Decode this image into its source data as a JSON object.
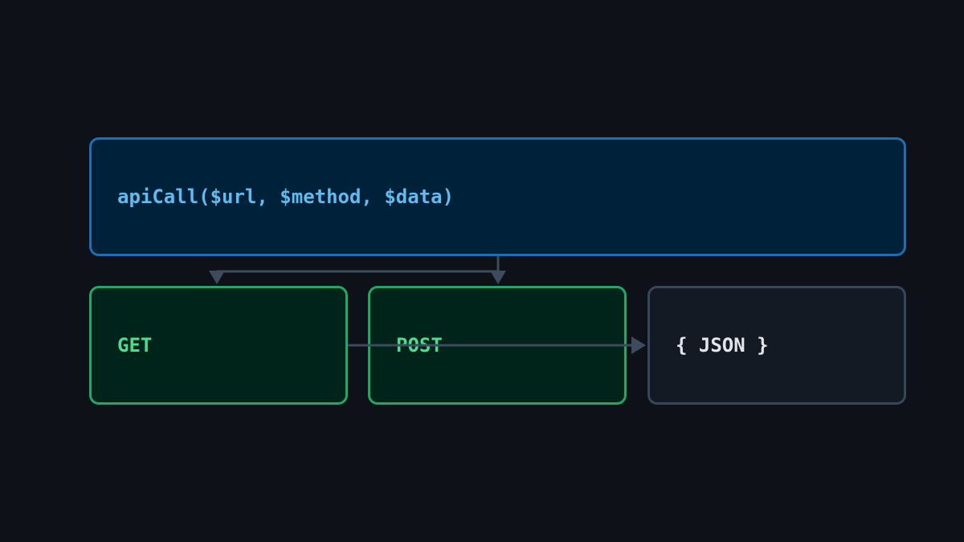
{
  "diagram": {
    "nodes": {
      "main": {
        "label": "apiCall($url, $method, $data)"
      },
      "get": {
        "label": "GET"
      },
      "post": {
        "label": "POST"
      },
      "json": {
        "label": "{ JSON }"
      }
    },
    "colors": {
      "background": "#0e1117",
      "main_border": "#1f6fb0",
      "main_fill": "#00213a",
      "main_text": "#64b9ee",
      "method_border": "#20a866",
      "method_fill": "#00231a",
      "method_text": "#4fdc90",
      "json_border": "#38465c",
      "json_fill": "#141a24",
      "json_text": "#e2e6ec",
      "connector": "#3e4a5e"
    },
    "edges": [
      {
        "from": "main",
        "to": "get"
      },
      {
        "from": "main",
        "to": "post"
      },
      {
        "from": "get",
        "to": "json"
      }
    ]
  }
}
